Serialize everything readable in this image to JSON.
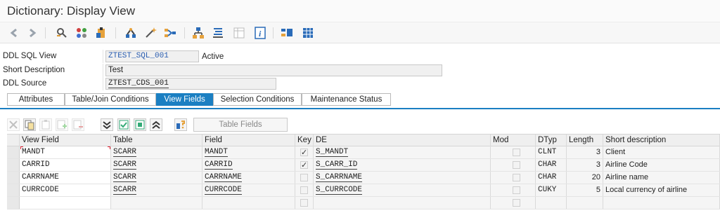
{
  "window": {
    "title": "Dictionary: Display View"
  },
  "toolbar": {
    "icons": [
      "back-icon",
      "forward-icon",
      "display-change-icon",
      "other-object-icon",
      "check-icon",
      "activate-icon",
      "where-used-icon",
      "magic-wand-icon",
      "object-list-icon",
      "hierarchy-icon",
      "display-object-list-icon",
      "table-icon",
      "info-icon",
      "layout-icon",
      "grid-icon"
    ]
  },
  "header": {
    "ddl_sql_view_label": "DDL SQL View",
    "ddl_sql_view_value": "ZTEST_SQL_001",
    "status": "Active",
    "short_desc_label": "Short Description",
    "short_desc_value": "Test",
    "ddl_source_label": "DDL Source",
    "ddl_source_value": "ZTEST_CDS_001"
  },
  "tabs": [
    {
      "label": "Attributes",
      "active": false
    },
    {
      "label": "Table/Join Conditions",
      "active": false
    },
    {
      "label": "View Fields",
      "active": true
    },
    {
      "label": "Selection Conditions",
      "active": false
    },
    {
      "label": "Maintenance Status",
      "active": false
    }
  ],
  "gridbar": {
    "table_fields_label": "Table Fields"
  },
  "grid": {
    "columns": [
      "View Field",
      "Table",
      "Field",
      "Key",
      "DE",
      "Mod",
      "DTyp",
      "Length",
      "Short description"
    ],
    "rows": [
      {
        "view_field": "MANDT",
        "table": "SCARR",
        "field": "MANDT",
        "key": true,
        "de": "S_MANDT",
        "mod": false,
        "dtyp": "CLNT",
        "length": "3",
        "desc": "Client"
      },
      {
        "view_field": "CARRID",
        "table": "SCARR",
        "field": "CARRID",
        "key": true,
        "de": "S_CARR_ID",
        "mod": false,
        "dtyp": "CHAR",
        "length": "3",
        "desc": "Airline Code"
      },
      {
        "view_field": "CARRNAME",
        "table": "SCARR",
        "field": "CARRNAME",
        "key": false,
        "de": "S_CARRNAME",
        "mod": false,
        "dtyp": "CHAR",
        "length": "20",
        "desc": "Airline name"
      },
      {
        "view_field": "CURRCODE",
        "table": "SCARR",
        "field": "CURRCODE",
        "key": false,
        "de": "S_CURRCODE",
        "mod": false,
        "dtyp": "CUKY",
        "length": "5",
        "desc": "Local currency of airline"
      },
      {
        "view_field": "",
        "table": "",
        "field": "",
        "key": false,
        "de": "",
        "mod": false,
        "dtyp": "",
        "length": "",
        "desc": ""
      }
    ]
  },
  "colors": {
    "accent": "#1b7fc2",
    "link": "#2a5db0"
  }
}
